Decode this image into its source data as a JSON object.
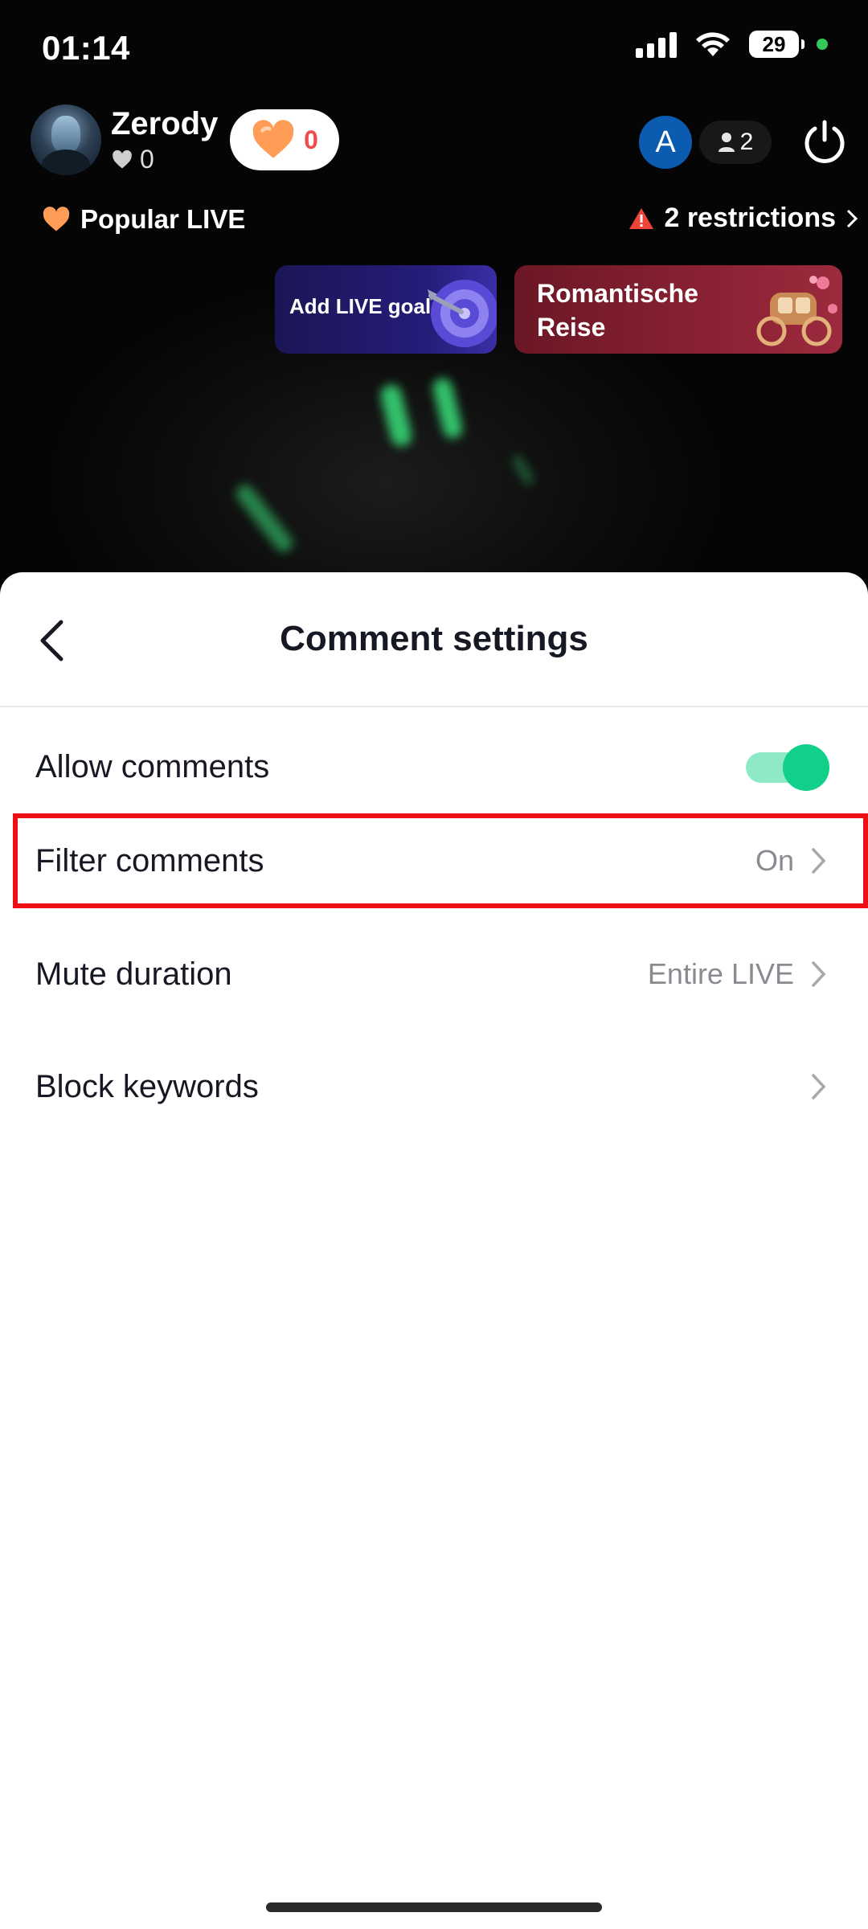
{
  "status_bar": {
    "time": "01:14",
    "battery": "29"
  },
  "live_header": {
    "streamer_name": "Zerody",
    "streamer_likes": "0",
    "gift_count": "0",
    "viewer_initial": "A",
    "viewer_count": "2",
    "popular_label": "Popular LIVE",
    "restrictions_label": "2 restrictions"
  },
  "promo_cards": {
    "goal_label": "Add LIVE goal",
    "gift_title": "Romantische Reise"
  },
  "sheet": {
    "title": "Comment settings",
    "rows": [
      {
        "label": "Allow comments",
        "value": "",
        "toggle_on": true
      },
      {
        "label": "Filter comments",
        "value": "On"
      },
      {
        "label": "Mute duration",
        "value": "Entire LIVE"
      },
      {
        "label": "Block keywords",
        "value": ""
      }
    ]
  },
  "colors": {
    "accent_green": "#11d08a",
    "highlight_red": "#ee0f14",
    "heart_orange": "#ff9c55"
  }
}
